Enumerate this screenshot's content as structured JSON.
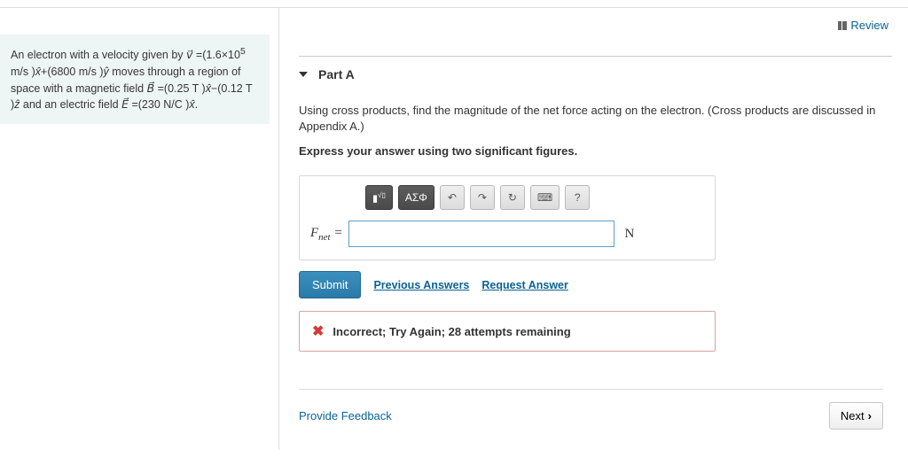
{
  "header": {
    "review_label": "Review"
  },
  "problem": {
    "text_html": "An electron with a velocity given by <i>v⃗</i> =(1.6×10<sup>5</sup> m/s )<i>x̂</i>+(6800 m/s )<i>ŷ</i> moves through a region of space with a magnetic field <i>B⃗</i> =(0.25 T )<i>x̂</i>−(0.12 T )<i>ẑ</i> and an electric field <i>E⃗</i> =(230 N/C )<i>x̂</i>."
  },
  "part": {
    "label": "Part A",
    "question": "Using cross products, find the magnitude of the net force acting on the electron. (Cross products are discussed in Appendix A.)",
    "instruction": "Express your answer using two significant figures.",
    "lhs_symbol": "F",
    "lhs_sub": "net",
    "equals": "=",
    "input_value": "",
    "unit": "N",
    "toolbar": {
      "math_templates": "√x",
      "greek": "ΑΣΦ",
      "undo": "↶",
      "redo": "↷",
      "reset": "↻",
      "keyboard": "⌨",
      "help": "?"
    },
    "submit_label": "Submit",
    "prev_answers": "Previous Answers",
    "request_answer": "Request Answer",
    "feedback": "Incorrect; Try Again; 28 attempts remaining"
  },
  "footer": {
    "provide_feedback": "Provide Feedback",
    "next": "Next"
  }
}
